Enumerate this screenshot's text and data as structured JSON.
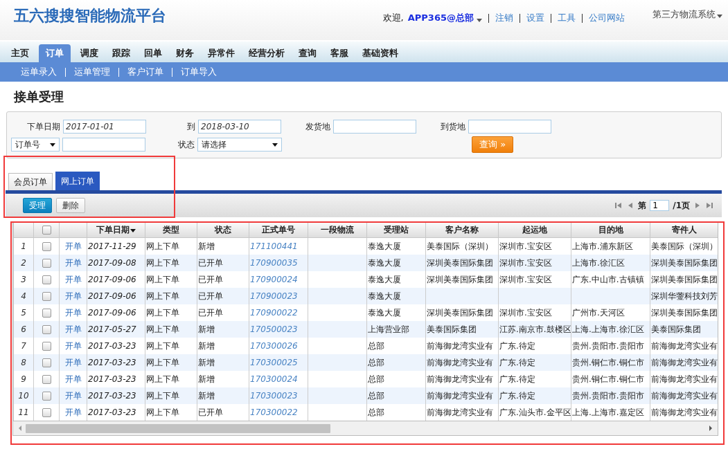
{
  "header": {
    "logo": "五六搜搜智能物流平台",
    "welcome": "欢迎,",
    "user": "APP365@总部",
    "links": [
      "注销",
      "设置",
      "工具",
      "公司网站"
    ],
    "system": "第三方物流系统"
  },
  "nav": [
    {
      "label": "主页",
      "selected": false
    },
    {
      "label": "订单",
      "selected": true
    },
    {
      "label": "调度",
      "selected": false
    },
    {
      "label": "跟踪",
      "selected": false
    },
    {
      "label": "回单",
      "selected": false
    },
    {
      "label": "财务",
      "selected": false
    },
    {
      "label": "异常件",
      "selected": false
    },
    {
      "label": "经营分析",
      "selected": false
    },
    {
      "label": "查询",
      "selected": false
    },
    {
      "label": "客服",
      "selected": false
    },
    {
      "label": "基础资料",
      "selected": false
    }
  ],
  "subnav": [
    "运单录入",
    "运单管理",
    "客户订单",
    "订单导入"
  ],
  "page_title": "接单受理",
  "filters": {
    "date_label": "下单日期",
    "date_from": "2017-01-01",
    "to_label": "到",
    "date_to": "2018-03-10",
    "origin_label": "发货地",
    "dest_label": "到货地",
    "field_select": "订单号",
    "status_label": "状态",
    "status_select": "请选择",
    "query_button": "查询 »"
  },
  "tabs": [
    {
      "label": "会员订单",
      "selected": false
    },
    {
      "label": "网上订单",
      "selected": true
    }
  ],
  "actions": [
    {
      "label": "受理",
      "kind": "primary"
    },
    {
      "label": "删除",
      "kind": "plain"
    }
  ],
  "pager": {
    "prefix": "第",
    "page": "1",
    "total": "/1页"
  },
  "table": {
    "all_checked": false,
    "columns": [
      "",
      "",
      "",
      "下单日期",
      "类型",
      "状态",
      "正式单号",
      "一段物流",
      "受理站",
      "客户名称",
      "起运地",
      "目的地",
      "寄件人"
    ],
    "rows": [
      {
        "index": "1",
        "checked": false,
        "action": "开单",
        "date": "2017-11-29",
        "type": "网上下单",
        "status": "新增",
        "number": "171100441",
        "stage": "",
        "station": "泰逸大厦",
        "customer": "美泰国际（深圳）",
        "from": "深圳市.宝安区",
        "to": "上海市.浦东新区",
        "sender": "美泰国际（深圳）"
      },
      {
        "index": "2",
        "checked": false,
        "action": "开单",
        "date": "2017-09-08",
        "type": "网上下单",
        "status": "已开单",
        "number": "170900035",
        "stage": "",
        "station": "泰逸大厦",
        "customer": "深圳美泰国际集团",
        "from": "深圳市.宝安区",
        "to": "上海市.徐汇区",
        "sender": "深圳美泰国际集团"
      },
      {
        "index": "3",
        "checked": false,
        "action": "开单",
        "date": "2017-09-06",
        "type": "网上下单",
        "status": "已开单",
        "number": "170900024",
        "stage": "",
        "station": "泰逸大厦",
        "customer": "深圳美泰国际集团",
        "from": "深圳市.宝安区",
        "to": "广东.中山市.古镇镇",
        "sender": "深圳美泰国际集团"
      },
      {
        "index": "4",
        "checked": false,
        "action": "开单",
        "date": "2017-09-06",
        "type": "网上下单",
        "status": "已开单",
        "number": "170900023",
        "stage": "",
        "station": "泰逸大厦",
        "customer": "",
        "from": "",
        "to": "",
        "sender": "深圳华蓥科技刘芳"
      },
      {
        "index": "5",
        "checked": false,
        "action": "开单",
        "date": "2017-09-06",
        "type": "网上下单",
        "status": "已开单",
        "number": "170900022",
        "stage": "",
        "station": "泰逸大厦",
        "customer": "深圳美泰国际集团",
        "from": "深圳市.宝安区",
        "to": "广州市.天河区",
        "sender": "深圳美泰国际集团"
      },
      {
        "index": "6",
        "checked": false,
        "action": "开单",
        "date": "2017-05-27",
        "type": "网上下单",
        "status": "新增",
        "number": "170500023",
        "stage": "",
        "station": "上海营业部",
        "customer": "美泰国际集团",
        "from": "江苏.南京市.鼓楼区",
        "to": "上海.上海市.徐汇区",
        "sender": "美泰国际集团"
      },
      {
        "index": "7",
        "checked": false,
        "action": "开单",
        "date": "2017-03-23",
        "type": "网上下单",
        "status": "新增",
        "number": "170300026",
        "stage": "",
        "station": "总部",
        "customer": "前海御龙湾实业有",
        "from": "广东.待定",
        "to": "贵州.贵阳市.贵阳市",
        "sender": "前海御龙湾实业有"
      },
      {
        "index": "8",
        "checked": false,
        "action": "开单",
        "date": "2017-03-23",
        "type": "网上下单",
        "status": "新增",
        "number": "170300025",
        "stage": "",
        "station": "总部",
        "customer": "前海御龙湾实业有",
        "from": "广东.待定",
        "to": "贵州.铜仁市.铜仁市",
        "sender": "前海御龙湾实业有"
      },
      {
        "index": "9",
        "checked": false,
        "action": "开单",
        "date": "2017-03-23",
        "type": "网上下单",
        "status": "新增",
        "number": "170300024",
        "stage": "",
        "station": "总部",
        "customer": "前海御龙湾实业有",
        "from": "广东.待定",
        "to": "贵州.铜仁市.铜仁市",
        "sender": "前海御龙湾实业有"
      },
      {
        "index": "10",
        "checked": false,
        "action": "开单",
        "date": "2017-03-23",
        "type": "网上下单",
        "status": "新增",
        "number": "170300023",
        "stage": "",
        "station": "总部",
        "customer": "前海御龙湾实业有",
        "from": "广东.待定",
        "to": "贵州.贵阳市.贵阳市",
        "sender": "前海御龙湾实业有"
      },
      {
        "index": "11",
        "checked": false,
        "action": "开单",
        "date": "2017-03-23",
        "type": "网上下单",
        "status": "已开单",
        "number": "170300022",
        "stage": "",
        "station": "总部",
        "customer": "前海御龙湾实业有",
        "from": "广东.汕头市.金平区",
        "to": "上海.上海市.嘉定区",
        "sender": "前海御龙湾实业有"
      }
    ]
  }
}
